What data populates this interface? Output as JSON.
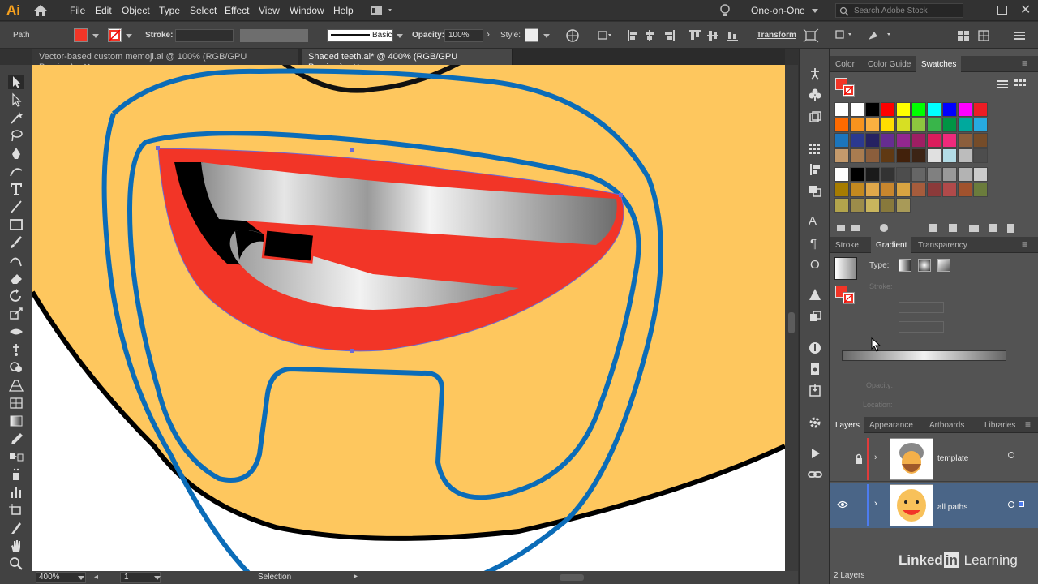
{
  "app": {
    "logo": "Ai"
  },
  "menu": {
    "items": [
      "File",
      "Edit",
      "Object",
      "Type",
      "Select",
      "Effect",
      "View",
      "Window",
      "Help"
    ]
  },
  "workspace": {
    "value": "One-on-One"
  },
  "search": {
    "placeholder": "Search Adobe Stock"
  },
  "control": {
    "object_type": "Path",
    "stroke_label": "Stroke:",
    "brush_value": "Basic",
    "opacity_label": "Opacity:",
    "opacity_value": "100%",
    "style_label": "Style:",
    "transform_label": "Transform",
    "fill_color": "#f23527"
  },
  "tabs": [
    {
      "label": "Vector-based custom memoji.ai @ 100% (RGB/GPU Preview)",
      "active": false
    },
    {
      "label": "Shaded teeth.ai* @ 400% (RGB/GPU Preview)",
      "active": true
    }
  ],
  "status": {
    "zoom": "400%",
    "artboard": "1",
    "tool": "Selection"
  },
  "swatches_panel": {
    "tabs": [
      "Color",
      "Color Guide",
      "Swatches"
    ],
    "rows": [
      [
        "#ffffff",
        "#ffffff",
        "#000000",
        "#ff0000",
        "#ffff00",
        "#00ff00",
        "#00ffff",
        "#0000ff",
        "#ff00ff",
        "#ed1c24"
      ],
      [
        "#ff6a00",
        "#f7931e",
        "#fbb040",
        "#ffdd00",
        "#d7df23",
        "#8dc63f",
        "#39b54a",
        "#009444",
        "#00a99d",
        "#27aae1"
      ],
      [
        "#1c75bc",
        "#2b3990",
        "#262262",
        "#662d91",
        "#92278f",
        "#9e1f63",
        "#da1c5c",
        "#ee2a7b",
        "#8b5e3c",
        "#754c29"
      ],
      [
        "#c49a6c",
        "#a97c50",
        "#8b5e3c",
        "#603913",
        "#42210b",
        "#3c2415",
        "#e0e0e0",
        "#b3dce6",
        "#bcbcbc",
        "#4d4d4d"
      ],
      [
        "#ffffff",
        "#000000",
        "#1a1a1a",
        "#333333",
        "#4d4d4d",
        "#666666",
        "#808080",
        "#999999",
        "#b3b3b3",
        "#cccccc"
      ],
      [
        "#a67c00",
        "#c4891f",
        "#e0a84a",
        "#c8862d",
        "#d9a441",
        "#a65c3c",
        "#8b3a3a",
        "#b04a4a",
        "#a0522d",
        "#6b7c3c"
      ],
      [
        "#b2a44c",
        "#9c8c4a",
        "#c9b55d",
        "#88793c",
        "#a89a58"
      ]
    ]
  },
  "gradient_panel": {
    "tabs": [
      "Stroke",
      "Gradient",
      "Transparency"
    ],
    "type_label": "Type:",
    "stroke_label": "Stroke:",
    "opacity_label": "Opacity:",
    "location_label": "Location:"
  },
  "layers_panel": {
    "tabs": [
      "Layers",
      "Appearance",
      "Artboards",
      "Libraries"
    ],
    "layers": [
      {
        "name": "template",
        "color": "#e03b3b",
        "locked": true
      },
      {
        "name": "all paths",
        "color": "#4d7cf0",
        "visible": true
      }
    ],
    "count": "2 Layers"
  },
  "watermark": {
    "text": "Linked in Learning"
  }
}
